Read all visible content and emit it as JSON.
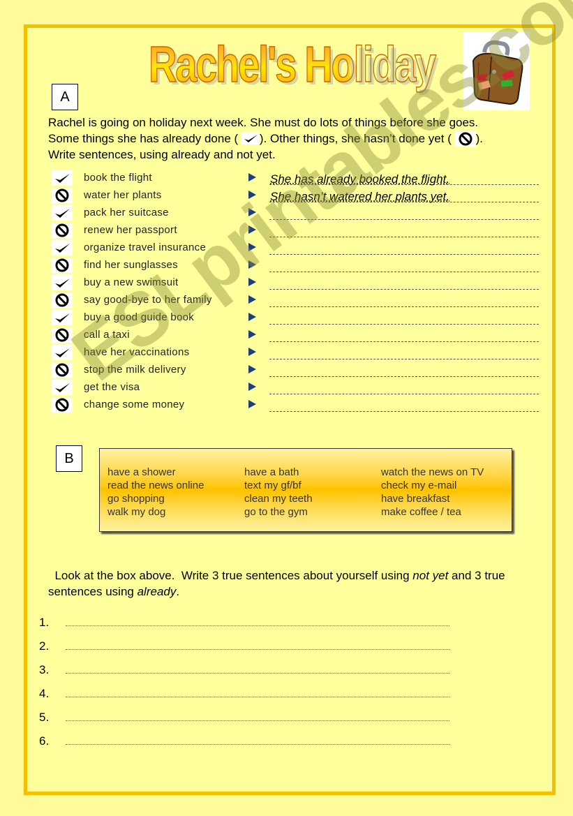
{
  "title": "Rachel's Holiday",
  "section_a": {
    "label": "A",
    "intro_line1": "Rachel is going on holiday next week. She must do lots of things before she goes.",
    "intro_line2_before": "Some things she has already done ( ",
    "intro_line2_middle": ").  Other things, she hasn’t done yet ( ",
    "intro_line2_after": ").",
    "intro_line3": "Write sentences, using already and not yet.",
    "items": [
      {
        "status": "done",
        "icon": "check-icon",
        "text": "book the flight"
      },
      {
        "status": "not-done",
        "icon": "prohibited-icon",
        "text": "water her plants"
      },
      {
        "status": "done",
        "icon": "check-icon",
        "text": "pack her suitcase"
      },
      {
        "status": "not-done",
        "icon": "prohibited-icon",
        "text": "renew her passport"
      },
      {
        "status": "done",
        "icon": "check-icon",
        "text": "organize travel insurance"
      },
      {
        "status": "not-done",
        "icon": "prohibited-icon",
        "text": "find her sunglasses"
      },
      {
        "status": "done",
        "icon": "check-icon",
        "text": "buy a new swimsuit"
      },
      {
        "status": "not-done",
        "icon": "prohibited-icon",
        "text": "say good-bye to her family"
      },
      {
        "status": "done",
        "icon": "check-icon",
        "text": "buy a good guide book"
      },
      {
        "status": "not-done",
        "icon": "prohibited-icon",
        "text": "call a taxi"
      },
      {
        "status": "done",
        "icon": "check-icon",
        "text": "have her vaccinations"
      },
      {
        "status": "not-done",
        "icon": "prohibited-icon",
        "text": "stop the milk delivery"
      },
      {
        "status": "done",
        "icon": "check-icon",
        "text": "get the visa"
      },
      {
        "status": "not-done",
        "icon": "prohibited-icon",
        "text": "change some money"
      }
    ],
    "answers": [
      "She has already booked the flight.",
      "She hasn’t watered her plants yet.",
      "",
      "",
      "",
      "",
      "",
      "",
      "",
      "",
      "",
      "",
      "",
      ""
    ]
  },
  "section_b": {
    "label": "B",
    "columns": [
      [
        "have a shower",
        "read the news online",
        "go shopping",
        "walk my dog"
      ],
      [
        "have a bath",
        "text my gf/bf",
        "clean my teeth",
        "go to the gym"
      ],
      [
        "watch the news on TV",
        "check my e-mail",
        "have breakfast",
        "make coffee / tea"
      ]
    ],
    "task_part1": "  Look at the box above.  Write 3 true sentences about yourself using ",
    "task_em1": "not yet",
    "task_part2": " and 3 true sentences using ",
    "task_em2": "already",
    "task_part3": ".",
    "numbers": [
      "1.",
      "2.",
      "3.",
      "4.",
      "5.",
      "6."
    ]
  },
  "watermark": "ESLprintables.com",
  "colors": {
    "page_bg": "#ffff9c",
    "border": "#f5c000",
    "arrow": "#1f3f7a",
    "title_orange": "#f7931e",
    "title_yellow": "#ffe800"
  }
}
